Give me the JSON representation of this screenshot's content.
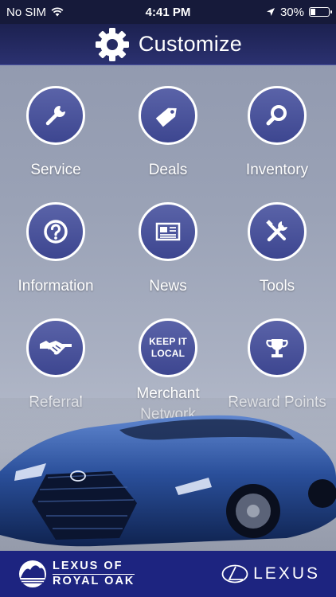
{
  "status_bar": {
    "carrier": "No SIM",
    "time": "4:41 PM",
    "battery": "30%",
    "battery_level": 0.3
  },
  "header": {
    "title": "Customize",
    "icon": "gear-icon"
  },
  "menu": [
    {
      "label": "Service",
      "icon": "wrench-icon"
    },
    {
      "label": "Deals",
      "icon": "tag-icon"
    },
    {
      "label": "Inventory",
      "icon": "magnifier-icon"
    },
    {
      "label": "Information",
      "icon": "question-icon"
    },
    {
      "label": "News",
      "icon": "newspaper-icon"
    },
    {
      "label": "Tools",
      "icon": "tools-icon"
    },
    {
      "label": "Referral",
      "icon": "handshake-icon"
    },
    {
      "label": "Merchant Network",
      "line1": "Merchant",
      "line2": "Network",
      "badge_line1": "KEEP IT",
      "badge_line2": "LOCAL"
    },
    {
      "label": "Reward Points",
      "icon": "trophy-icon"
    }
  ],
  "footer": {
    "dealer_line1": "LEXUS OF",
    "dealer_line2": "ROYAL OAK",
    "brand": "LEXUS"
  },
  "colors": {
    "header_bg": "#1c2150",
    "footer_bg": "#1d2480",
    "icon_circle": "#4a539c",
    "car_body": "#1f3f8a"
  }
}
